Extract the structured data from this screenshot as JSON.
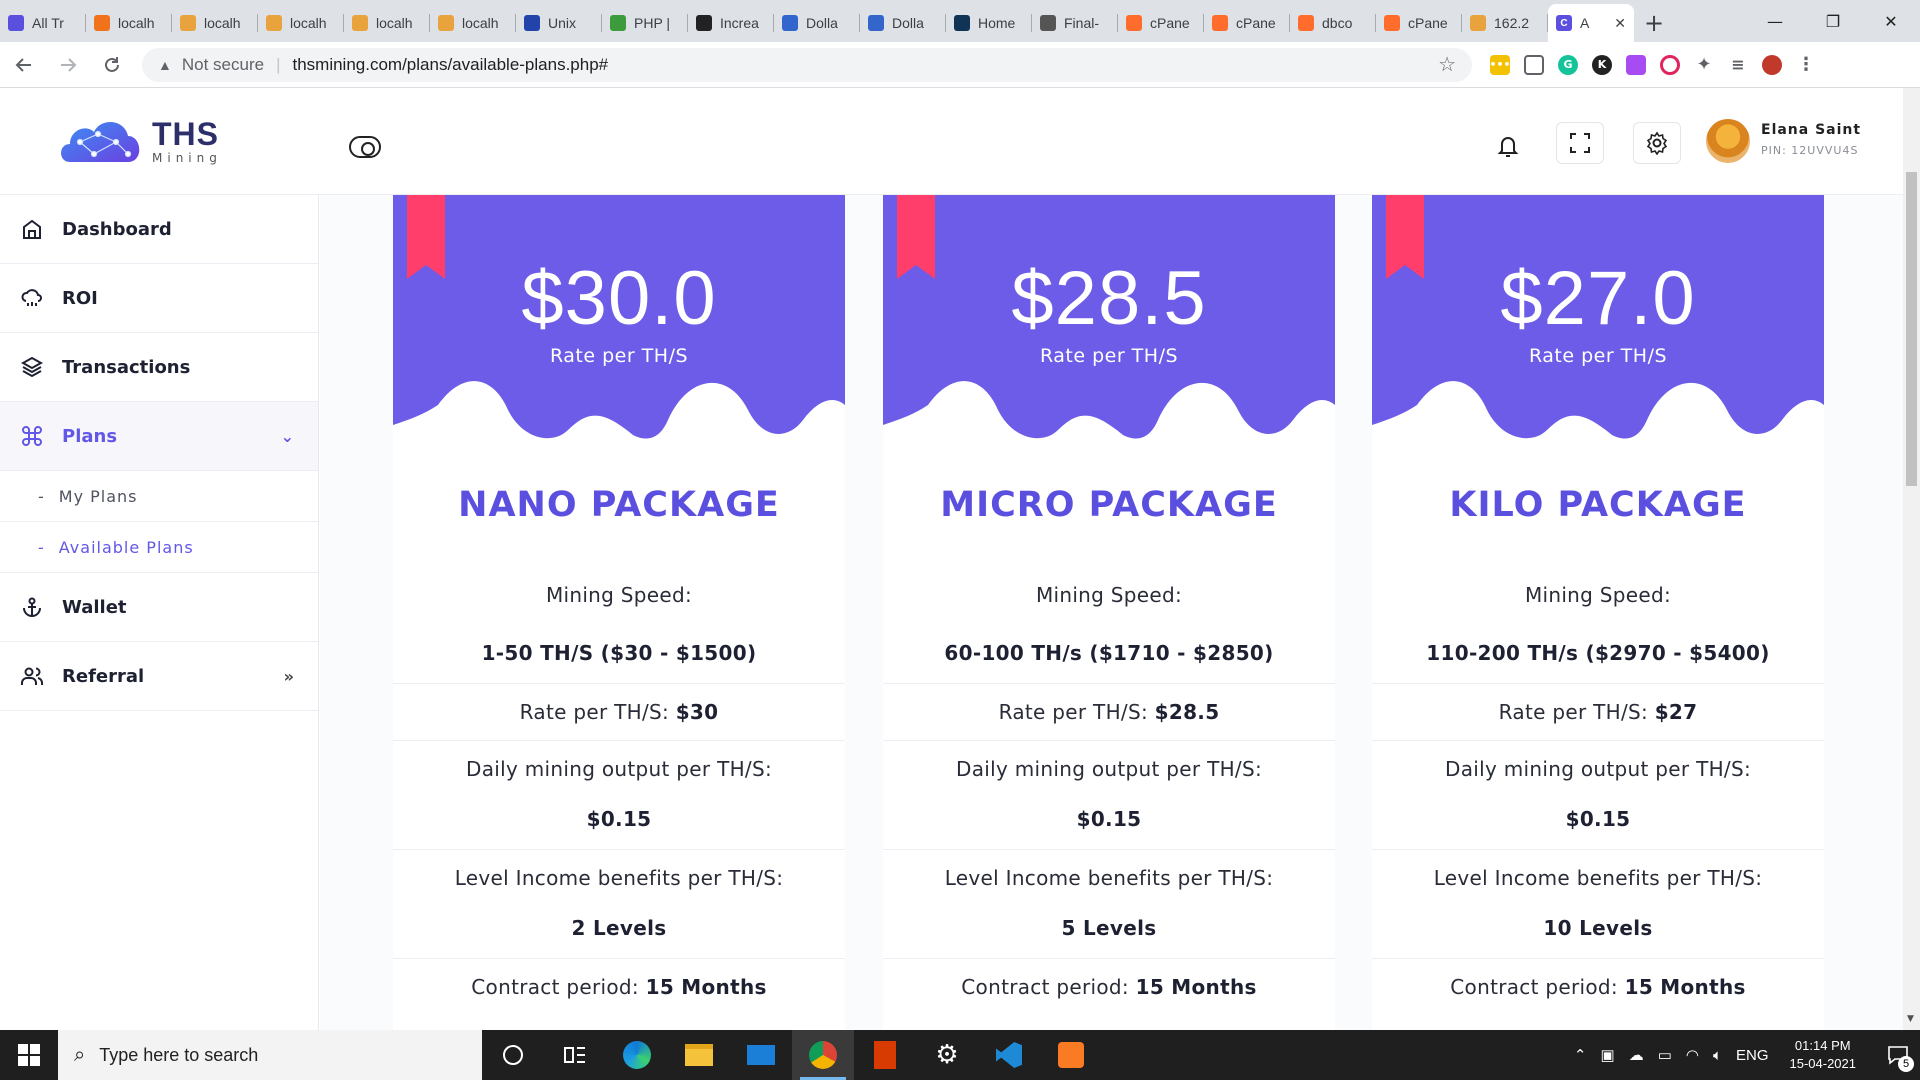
{
  "browser": {
    "tabs": [
      {
        "label": "All Tr",
        "fav": "#5b4fe0"
      },
      {
        "label": "localh",
        "fav": "#f0731c"
      },
      {
        "label": "localh",
        "fav": "#e8a33c"
      },
      {
        "label": "localh",
        "fav": "#e8a33c"
      },
      {
        "label": "localh",
        "fav": "#e8a33c"
      },
      {
        "label": "localh",
        "fav": "#e8a33c"
      },
      {
        "label": "Unix",
        "fav": "#2244aa"
      },
      {
        "label": "PHP |",
        "fav": "#3c9c3c"
      },
      {
        "label": "Increa",
        "fav": "#222222"
      },
      {
        "label": "Dolla",
        "fav": "#3366cc"
      },
      {
        "label": "Dolla",
        "fav": "#3366cc"
      },
      {
        "label": "Home",
        "fav": "#113355"
      },
      {
        "label": "Final-",
        "fav": "#555555"
      },
      {
        "label": "cPane",
        "fav": "#ff6c2c"
      },
      {
        "label": "cPane",
        "fav": "#ff6c2c"
      },
      {
        "label": "dbco",
        "fav": "#ff6c2c"
      },
      {
        "label": "cPane",
        "fav": "#ff6c2c"
      },
      {
        "label": "162.2",
        "fav": "#e8a33c"
      }
    ],
    "active_tab": {
      "label": "A",
      "fav": "#5b4fe0"
    },
    "new_tab": "+",
    "window_controls": [
      "—",
      "❐",
      "✕"
    ],
    "security_label": "Not secure",
    "url": "thsmining.com/plans/available-plans.php#"
  },
  "header": {
    "brand": "THS",
    "brand_sub": "Mining",
    "user_name": "Elana Saint",
    "user_pin": "PIN: 12UVVU4S"
  },
  "sidebar": {
    "items": [
      {
        "label": "Dashboard",
        "icon": "home-icon"
      },
      {
        "label": "ROI",
        "icon": "cloud-rain-icon"
      },
      {
        "label": "Transactions",
        "icon": "layers-icon"
      },
      {
        "label": "Plans",
        "icon": "command-icon",
        "expanded": true
      },
      {
        "label": "Wallet",
        "icon": "anchor-icon"
      },
      {
        "label": "Referral",
        "icon": "users-icon"
      }
    ],
    "plans_chevron": "⌄",
    "referral_chevron": "»",
    "sub_items": [
      {
        "label": "My Plans"
      },
      {
        "label": "Available Plans",
        "current": true
      }
    ],
    "sub_marker": "-"
  },
  "plans": [
    {
      "price": "$30.0",
      "rate_label": "Rate per TH/S",
      "name": "NANO PACKAGE",
      "speed_label": "Mining Speed:",
      "speed_value": "1-50 TH/S ($30 - $1500)",
      "rate_prefix": "Rate per TH/S: ",
      "rate_value": "$30",
      "output_label": "Daily mining output per TH/S:",
      "output_value": "$0.15",
      "level_label": "Level Income benefits per TH/S:",
      "level_value": "2 Levels",
      "contract_prefix": "Contract period: ",
      "contract_value": "15 Months"
    },
    {
      "price": "$28.5",
      "rate_label": "Rate per TH/S",
      "name": "MICRO PACKAGE",
      "speed_label": "Mining Speed:",
      "speed_value": "60-100 TH/s ($1710 - $2850)",
      "rate_prefix": "Rate per TH/S: ",
      "rate_value": "$28.5",
      "output_label": "Daily mining output per TH/S:",
      "output_value": "$0.15",
      "level_label": "Level Income benefits per TH/S:",
      "level_value": "5 Levels",
      "contract_prefix": "Contract period: ",
      "contract_value": "15 Months"
    },
    {
      "price": "$27.0",
      "rate_label": "Rate per TH/S",
      "name": "KILO PACKAGE",
      "speed_label": "Mining Speed:",
      "speed_value": "110-200 TH/s ($2970 - $5400)",
      "rate_prefix": "Rate per TH/S: ",
      "rate_value": "$27",
      "output_label": "Daily mining output per TH/S:",
      "output_value": "$0.15",
      "level_label": "Level Income benefits per TH/S:",
      "level_value": "10 Levels",
      "contract_prefix": "Contract period: ",
      "contract_value": "15 Months"
    }
  ],
  "taskbar": {
    "search_placeholder": "Type here to search",
    "lang": "ENG",
    "time": "01:14 PM",
    "date": "15-04-2021",
    "notification_count": "5"
  },
  "colors": {
    "accent": "#6357e8",
    "card_top": "#6c5ce7",
    "ribbon": "#ff3e6c"
  }
}
